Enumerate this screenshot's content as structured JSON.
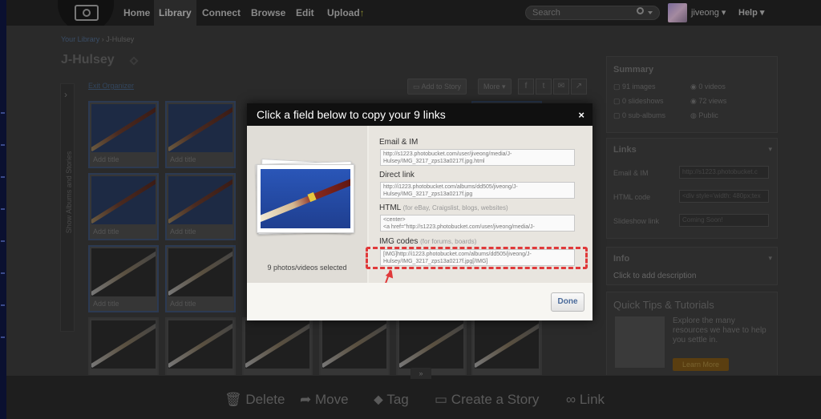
{
  "nav": {
    "items": [
      "Home",
      "Library",
      "Connect",
      "Browse",
      "Edit",
      "Upload"
    ],
    "active": "Library",
    "search_placeholder": "Search",
    "username": "jiveong",
    "help": "Help"
  },
  "breadcrumb": {
    "root": "Your Library",
    "sep": "›",
    "current": "J-Hulsey"
  },
  "page_title": "J-Hulsey",
  "sidebar_tab": "Show Albums and Stories",
  "exit_organizer": "Exit Organizer",
  "toolbar": {
    "add_to_story": "Add to Story",
    "more": "More"
  },
  "thumb_caption": "Add title",
  "summary": {
    "title": "Summary",
    "images": "91 images",
    "videos": "0 videos",
    "slideshows": "0 slideshows",
    "views": "72 views",
    "sub_albums": "0 sub-albums",
    "privacy": "Public"
  },
  "links_panel": {
    "title": "Links",
    "email_label": "Email & IM",
    "email_value": "http://s1223.photobucket.c",
    "html_label": "HTML code",
    "html_value": "<div style='width: 480px;tex",
    "slideshow_label": "Slideshow link",
    "slideshow_value": "Coming Soon!"
  },
  "info_panel": {
    "title": "Info",
    "description": "Click to add description"
  },
  "tips": {
    "title": "Quick Tips & Tutorials",
    "body": "Explore the many resources we have to help you settle in.",
    "button": "Learn More"
  },
  "bottom_actions": [
    "Delete",
    "Move",
    "Tag",
    "Create a Story",
    "Link"
  ],
  "modal": {
    "title": "Click a field below to copy your 9 links",
    "close": "×",
    "selected": "9 photos/videos selected",
    "email_label": "Email & IM",
    "email_value": "http://s1223.photobucket.com/user/jiveong/media/J-Hulsey/IMG_3217_zps13a0217f.jpg.html",
    "direct_label": "Direct link",
    "direct_value": "http://i1223.photobucket.com/albums/dd505/jiveong/J-Hulsey/IMG_3217_zps13a0217f.jpg",
    "html_label": "HTML",
    "html_hint": "(for eBay, Craigslist, blogs, websites)",
    "html_value": "<center>\n<a href=\"http://s1223.photobucket.com/user/jiveong/media/J-",
    "img_label": "IMG codes",
    "img_hint": "(for forums, boards)",
    "img_value": "[IMG]http://i1223.photobucket.com/albums/dd505/jiveong/J-Hulsey/IMG_3217_zps13a0217f.jpg[/IMG]",
    "done": "Done"
  },
  "colors": {
    "highlight": "#e0393a",
    "modal_head": "#101010",
    "done_text": "#4a6a9a"
  }
}
